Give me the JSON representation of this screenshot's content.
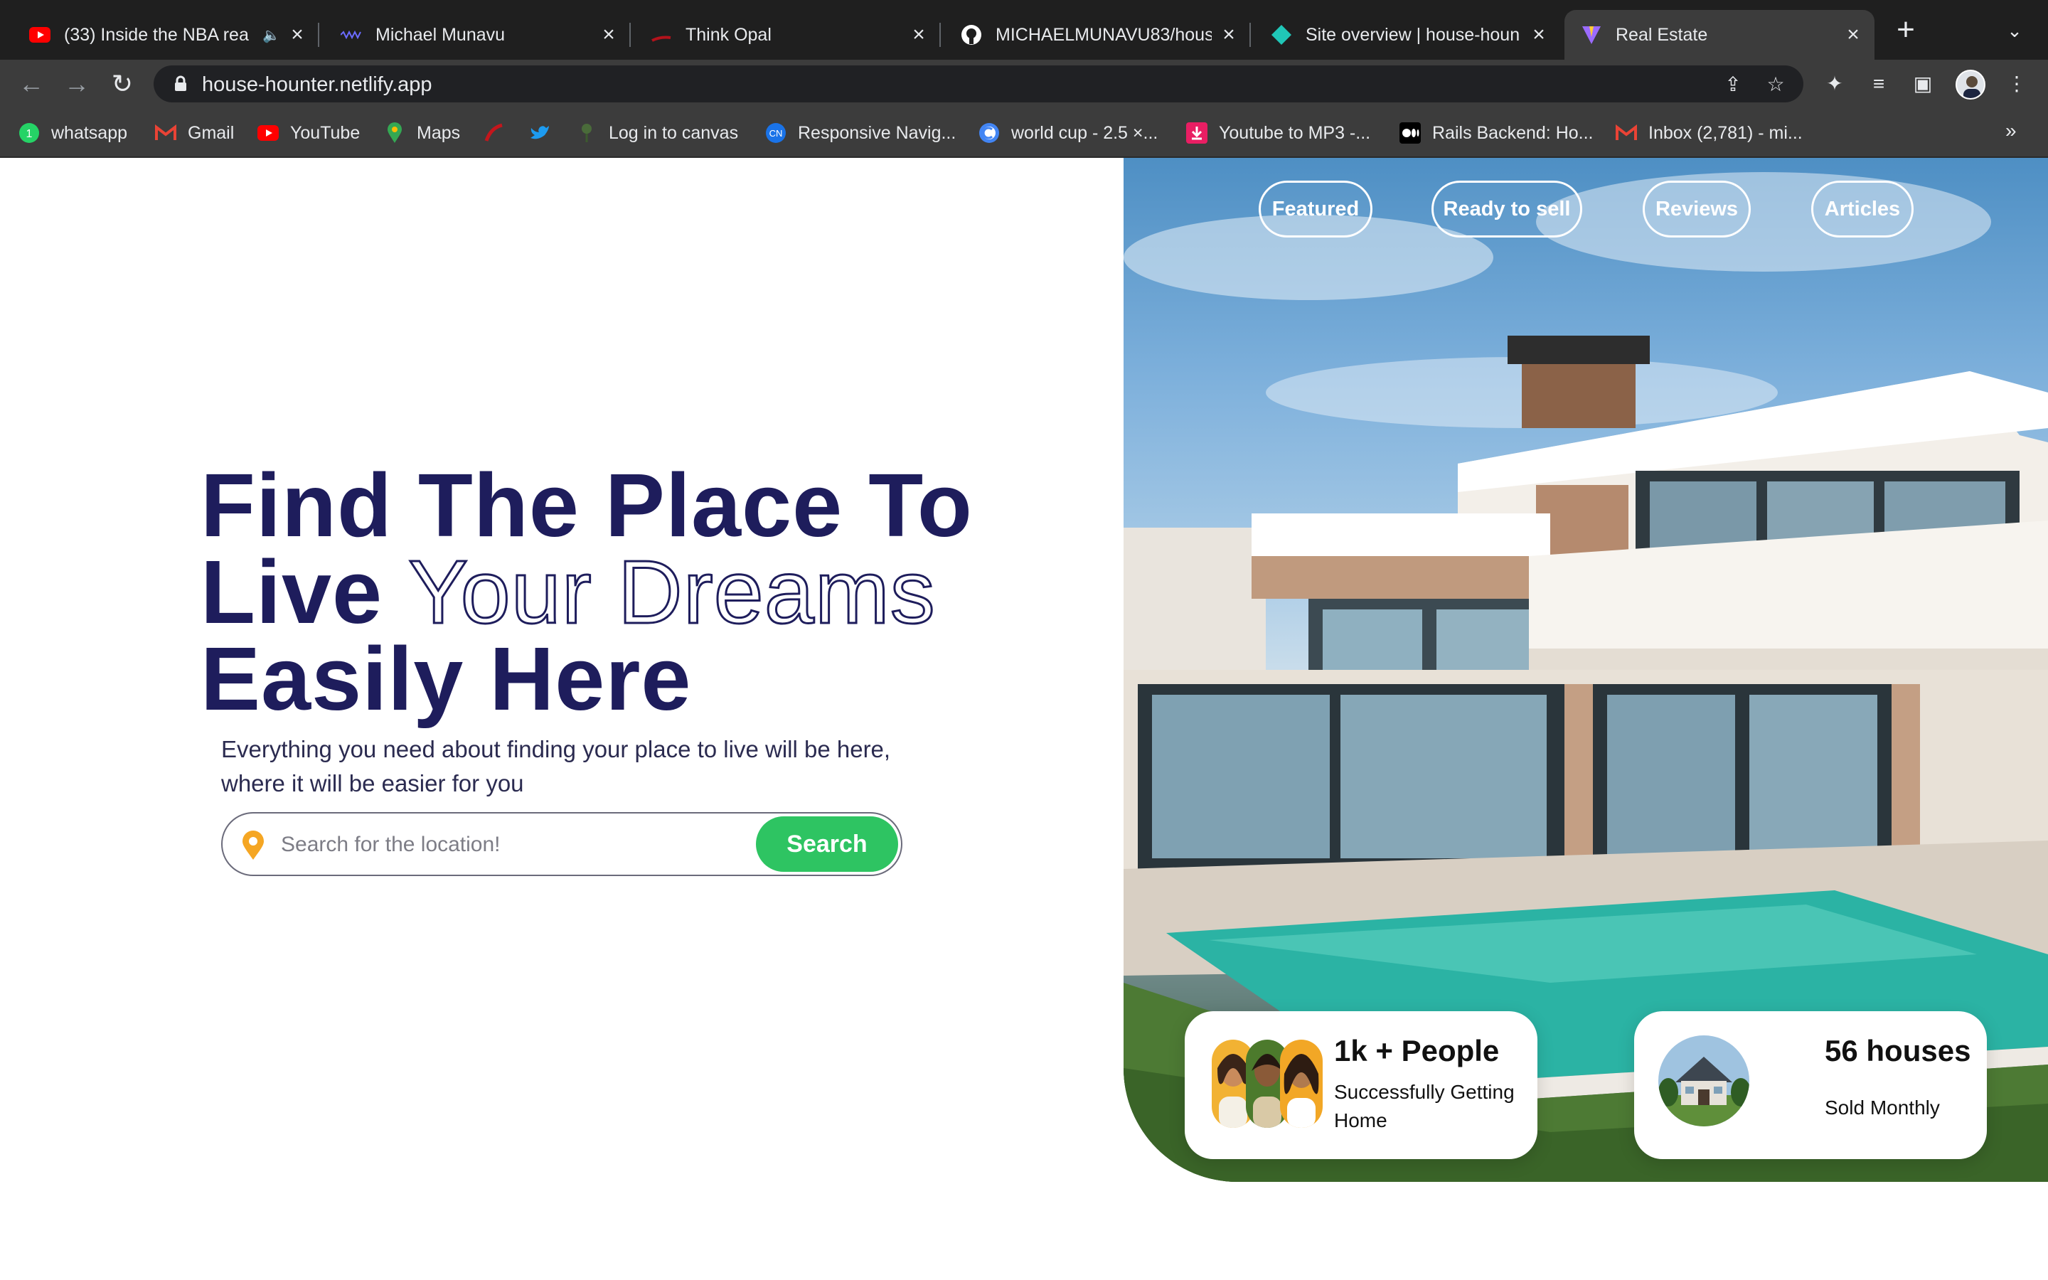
{
  "browser": {
    "tabs": [
      {
        "title": "(33) Inside the NBA rea",
        "icon": "youtube-icon",
        "muted_indicator": true
      },
      {
        "title": "Michael Munavu",
        "icon": "site-icon"
      },
      {
        "title": "Think Opal",
        "icon": "opal-icon"
      },
      {
        "title": "MICHAELMUNAVU83/housi",
        "icon": "github-icon"
      },
      {
        "title": "Site overview | house-houn",
        "icon": "netlify-icon"
      },
      {
        "title": "Real Estate",
        "icon": "vite-icon",
        "active": true
      }
    ],
    "url": "house-hounter.netlify.app",
    "bookmarks": [
      {
        "label": "whatsapp",
        "icon": "whatsapp-icon",
        "badge": "1"
      },
      {
        "label": "Gmail",
        "icon": "gmail-icon"
      },
      {
        "label": "YouTube",
        "icon": "youtube-icon"
      },
      {
        "label": "Maps",
        "icon": "maps-icon"
      },
      {
        "label": "",
        "icon": "bookmark-red-icon"
      },
      {
        "label": "",
        "icon": "twitter-icon"
      },
      {
        "label": "Log in to canvas",
        "icon": "canvas-icon"
      },
      {
        "label": "Responsive Navig...",
        "icon": "codepen-icon"
      },
      {
        "label": "world cup - 2.5 ×...",
        "icon": "chrome-icon"
      },
      {
        "label": "Youtube to MP3 -...",
        "icon": "download-icon"
      },
      {
        "label": "Rails Backend: Ho...",
        "icon": "medium-icon"
      },
      {
        "label": "Inbox (2,781) - mi...",
        "icon": "gmail-icon"
      }
    ],
    "bookmarks_more": "»"
  },
  "hero": {
    "title_line1": "Find The Place To",
    "title_line2_bold": "Live",
    "title_line2_outline": "Your Dreams",
    "title_line3": "Easily Here",
    "description_line1": "Everything you need about finding your place to live will be here,",
    "description_line2": "where it will be easier for you",
    "search_placeholder": "Search for the location!",
    "search_button": "Search"
  },
  "nav": {
    "links": [
      "Featured",
      "Ready to sell",
      "Reviews",
      "Articles"
    ]
  },
  "stats": {
    "people_title": "1k + People",
    "people_sub_line1": "Successfully Getting",
    "people_sub_line2": "Home",
    "houses_title": "56 houses",
    "houses_sub": "Sold Monthly"
  },
  "colors": {
    "brand_navy": "#1e1d5c",
    "search_green": "#2ec462",
    "chrome_dark": "#1f1f1f",
    "chrome_toolbar": "#3c3c3c"
  }
}
